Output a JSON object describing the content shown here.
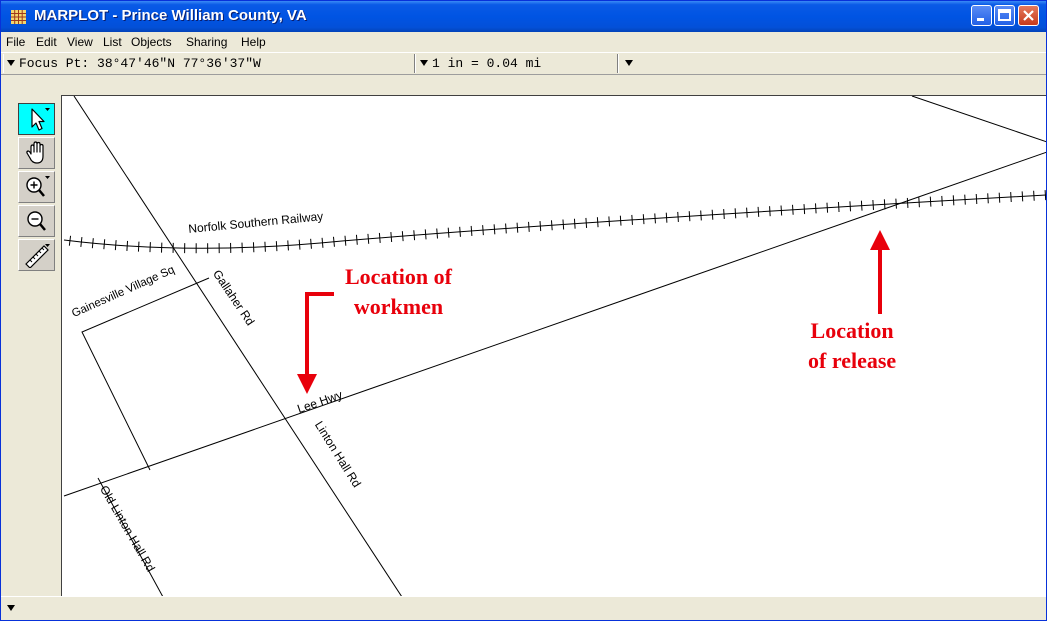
{
  "window": {
    "title": "MARPLOT - Prince William County, VA"
  },
  "menu": [
    "File",
    "Edit",
    "View",
    "List",
    "Objects",
    "Sharing",
    "Help"
  ],
  "statusbar": {
    "focus": "Focus Pt: 38°47′46″N   77°36′37″W",
    "scale": "1 in = 0.04 mi"
  },
  "tools": [
    "arrow-icon",
    "hand-icon",
    "zoom-in-icon",
    "zoom-out-icon",
    "ruler-icon"
  ],
  "map": {
    "roads": {
      "railway": "Norfolk Southern Railway",
      "gainesville": "Gainesville Village Sq",
      "gallaher": "Gallaher Rd",
      "lee": "Lee Hwy",
      "linton": "Linton Hall Rd",
      "old_linton": "Old Linton Hall Rd"
    },
    "annotations": {
      "workmen": "Location of workmen",
      "workmen_line1": "Location of",
      "workmen_line2": "workmen",
      "release": "Location of release",
      "release_line1": "Location",
      "release_line2": "of release"
    },
    "annotation_color": "#e8000b"
  }
}
